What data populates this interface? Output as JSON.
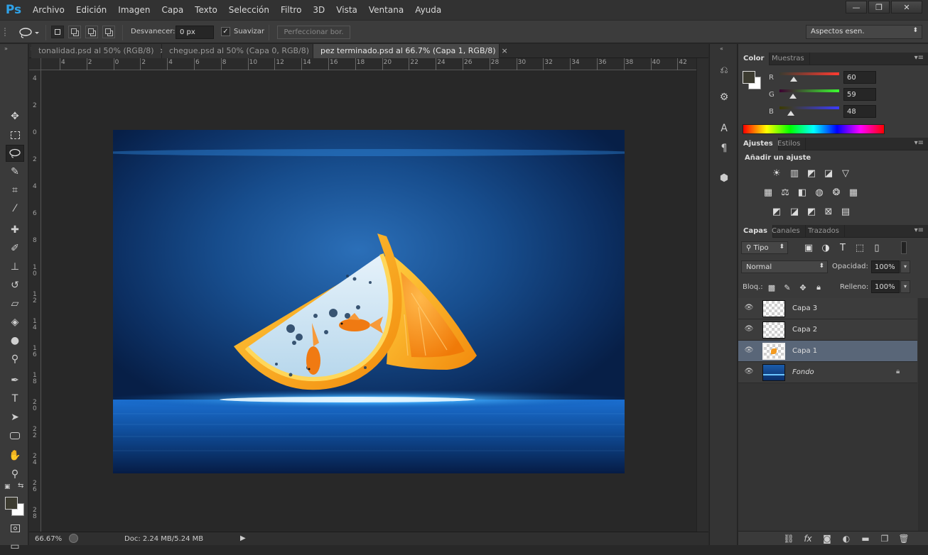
{
  "app": {
    "logo": "Ps"
  },
  "menu": [
    "Archivo",
    "Edición",
    "Imagen",
    "Capa",
    "Texto",
    "Selección",
    "Filtro",
    "3D",
    "Vista",
    "Ventana",
    "Ayuda"
  ],
  "window_controls": [
    "—",
    "❐",
    "✕"
  ],
  "options": {
    "feather_label": "Desvanecer:",
    "feather_value": "0 px",
    "antialias_label": "Suavizar",
    "antialias_checked": true,
    "refine_label": "Perfeccionar bor.",
    "workspace": "Aspectos esen."
  },
  "tabs": [
    {
      "label": "tonalidad.psd al 50% (RGB/8)",
      "active": false
    },
    {
      "label": "chegue.psd al 50% (Capa 0, RGB/8)",
      "active": false
    },
    {
      "label": "pez terminado.psd al 66.7% (Capa 1, RGB/8)",
      "active": true
    }
  ],
  "tab_close": "×",
  "ruler_h": [
    "4",
    "2",
    "0",
    "2",
    "4",
    "6",
    "8",
    "10",
    "12",
    "14",
    "16",
    "18",
    "20",
    "22",
    "24",
    "26",
    "28",
    "30",
    "32",
    "34",
    "36",
    "38",
    "40",
    "42"
  ],
  "ruler_v": [
    "4",
    "2",
    "0",
    "2",
    "4",
    "6",
    "8",
    "10",
    "12",
    "14",
    "16",
    "18",
    "20",
    "22",
    "24",
    "26",
    "28"
  ],
  "status": {
    "zoom": "66.67%",
    "doc": "Doc: 2.24 MB/5.24 MB"
  },
  "color_panel": {
    "tabs": [
      "Color",
      "Muestras"
    ],
    "channels": [
      {
        "label": "R",
        "value": "60",
        "color": "#c83030"
      },
      {
        "label": "G",
        "value": "59",
        "color": "#30b030"
      },
      {
        "label": "B",
        "value": "48",
        "color": "#3040d0"
      }
    ],
    "foreground": "#3c3b30",
    "background": "#ffffff"
  },
  "adjustments_panel": {
    "tabs": [
      "Ajustes",
      "Estilos"
    ],
    "title": "Añadir un ajuste"
  },
  "layers_panel": {
    "tabs": [
      "Capas",
      "Canales",
      "Trazados"
    ],
    "filter_kind": "Tipo",
    "blend_mode": "Normal",
    "opacity_label": "Opacidad:",
    "opacity_value": "100%",
    "lock_label": "Bloq.:",
    "fill_label": "Relleno:",
    "fill_value": "100%",
    "layers": [
      {
        "name": "Capa 3",
        "selected": false,
        "locked": false
      },
      {
        "name": "Capa 2",
        "selected": false,
        "locked": false
      },
      {
        "name": "Capa 1",
        "selected": true,
        "locked": false
      },
      {
        "name": "Fondo",
        "selected": false,
        "locked": true
      }
    ]
  }
}
